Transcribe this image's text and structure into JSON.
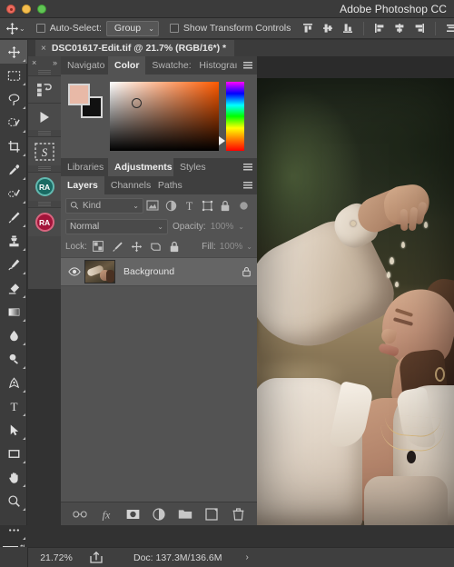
{
  "window": {
    "app_title": "Adobe Photoshop CC",
    "traffic_lights": [
      "close",
      "minimize",
      "maximize"
    ]
  },
  "options_bar": {
    "active_tool_icon": "move-tool-icon",
    "tool_preset_caret": "⌄",
    "auto_select": {
      "label": "Auto-Select:",
      "checked": false
    },
    "auto_select_scope": {
      "value": "Group",
      "caret": "⌄"
    },
    "show_transform_controls": {
      "label": "Show Transform Controls",
      "checked": false
    },
    "align_buttons": [
      "align-top-edges-icon",
      "align-vertical-centers-icon",
      "align-bottom-edges-icon",
      "align-left-edges-icon",
      "align-horizontal-centers-icon",
      "align-right-edges-icon",
      "distribute-vertical-icon"
    ]
  },
  "tools": [
    {
      "name": "move-tool",
      "active": true
    },
    {
      "name": "rectangular-marquee-tool",
      "active": false
    },
    {
      "name": "lasso-tool",
      "active": false
    },
    {
      "name": "quick-selection-tool",
      "active": false
    },
    {
      "name": "crop-tool",
      "active": false
    },
    {
      "name": "eyedropper-tool",
      "active": false
    },
    {
      "name": "spot-healing-brush-tool",
      "active": false
    },
    {
      "name": "brush-tool",
      "active": false
    },
    {
      "name": "clone-stamp-tool",
      "active": false
    },
    {
      "name": "history-brush-tool",
      "active": false
    },
    {
      "name": "eraser-tool",
      "active": false
    },
    {
      "name": "gradient-tool",
      "active": false
    },
    {
      "name": "blur-tool",
      "active": false
    },
    {
      "name": "dodge-tool",
      "active": false
    },
    {
      "name": "pen-tool",
      "active": false
    },
    {
      "name": "type-tool",
      "active": false
    },
    {
      "name": "path-selection-tool",
      "active": false
    },
    {
      "name": "rectangle-tool",
      "active": false
    },
    {
      "name": "hand-tool",
      "active": false
    },
    {
      "name": "zoom-tool",
      "active": false
    },
    {
      "name": "edit-toolbar-tool",
      "active": false
    }
  ],
  "tool_swatches": {
    "foreground_color": "#e8b9a7",
    "background_color": "#000000"
  },
  "icon_dock": {
    "collapse_icon": "×",
    "expand_icon": "»",
    "items": [
      {
        "name": "history-panel-icon",
        "label": ""
      },
      {
        "name": "actions-play-icon",
        "label": ""
      },
      {
        "name": "select-subject-icon",
        "label": ""
      },
      {
        "name": "retouch4me-teal-badge",
        "label": "RA",
        "color": "#1a6a63"
      },
      {
        "name": "retouch4me-crimson-badge",
        "label": "RA",
        "color": "#a3143a"
      }
    ]
  },
  "document_tab": {
    "close_glyph": "×",
    "title": "DSC01617-Edit.tif @ 21.7% (RGB/16*) *"
  },
  "panels": {
    "color_group": {
      "tabs": [
        {
          "label": "Navigato",
          "active": false
        },
        {
          "label": "Color",
          "active": true
        },
        {
          "label": "Swatche:",
          "active": false
        },
        {
          "label": "Histograı",
          "active": false
        }
      ],
      "menu_icon": "panel-menu-icon",
      "foreground_color": "#e8b9a7",
      "background_color": "#111111",
      "field_hue": "#ff5a00"
    },
    "adjustments_group": {
      "tabs": [
        {
          "label": "Libraries",
          "active": false
        },
        {
          "label": "Adjustments",
          "active": true
        },
        {
          "label": "Styles",
          "active": false
        }
      ],
      "menu_icon": "panel-menu-icon"
    },
    "layers_group": {
      "tabs": [
        {
          "label": "Layers",
          "active": true
        },
        {
          "label": "Channels",
          "active": false
        },
        {
          "label": "Paths",
          "active": false
        }
      ],
      "menu_icon": "panel-menu-icon"
    }
  },
  "layers_panel": {
    "filter": {
      "search_icon": "search-icon",
      "kind_value": "Kind",
      "caret": "⌄",
      "type_filters": [
        "filter-pixel-layers-icon",
        "filter-adjustment-layers-icon",
        "filter-type-layers-icon",
        "filter-shape-layers-icon",
        "filter-smart-object-layers-icon"
      ],
      "toggle_icon": "filter-enable-toggle-icon"
    },
    "blend_mode": {
      "value": "Normal",
      "caret": "⌄"
    },
    "opacity": {
      "label": "Opacity:",
      "value": "100%",
      "caret": "⌄"
    },
    "lock": {
      "label": "Lock:",
      "icons": [
        "lock-transparent-pixels-icon",
        "lock-image-pixels-icon",
        "lock-position-icon",
        "lock-artboard-nesting-icon",
        "lock-all-icon"
      ]
    },
    "fill": {
      "label": "Fill:",
      "value": "100%",
      "caret": "⌄"
    },
    "layers": [
      {
        "name": "Background",
        "visible": true,
        "visibility_icon": "eye-icon",
        "lock_icon": "lock-icon",
        "selected": true
      }
    ],
    "footer_buttons": [
      "link-layers-icon",
      "layer-style-fx-icon",
      "add-layer-mask-icon",
      "new-adjustment-layer-icon",
      "new-group-icon",
      "new-layer-icon",
      "delete-layer-icon"
    ]
  },
  "status_bar": {
    "zoom": "21.72%",
    "share_icon": "share-icon",
    "doc_info": "Doc: 137.3M/136.6M",
    "expand_chevron": "›"
  },
  "colors": {
    "titlebar_bg": "#3b3b3b",
    "options_bg": "#454545",
    "panel_bg": "#535353",
    "panel_tabbar_bg": "#3f3f3f",
    "tool_strip_bg": "#3c3c3c",
    "canvas_bg": "#2b2b2b",
    "layer_row_selected": "#656565"
  }
}
